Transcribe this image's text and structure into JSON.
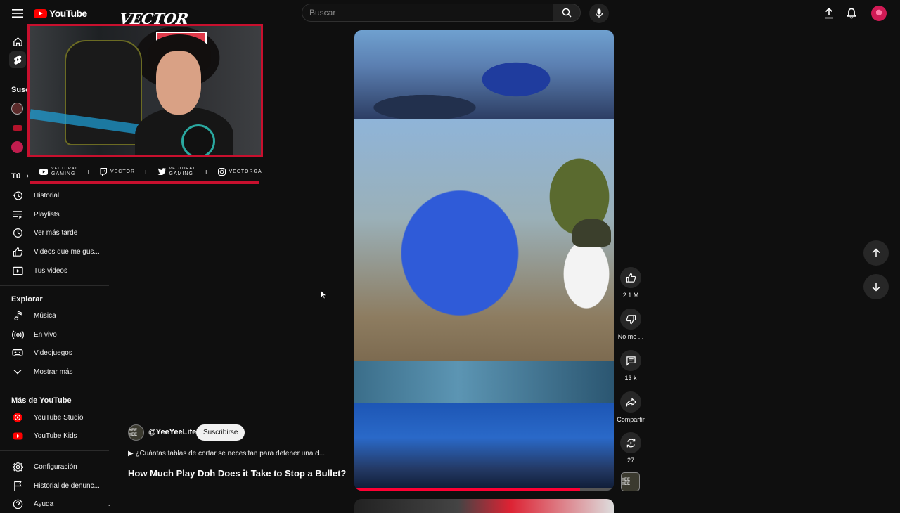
{
  "app": {
    "logo_text": "YouTube"
  },
  "search": {
    "placeholder": "Buscar"
  },
  "overlay": {
    "brand": "VECTOR",
    "socials": [
      {
        "icon": "youtube-icon",
        "line1": "VECTORAT",
        "line2": "GAMING"
      },
      {
        "icon": "twitch-icon",
        "line1": "VECTOR",
        "line2": ""
      },
      {
        "icon": "twitter-icon",
        "line1": "VECTORAT",
        "line2": "GAMING"
      },
      {
        "icon": "instagram-icon",
        "line1": "VECTORGA",
        "line2": ""
      }
    ]
  },
  "sidebar": {
    "subs_heading_partial": "Susc",
    "you_heading": "Tú",
    "you_items": [
      {
        "icon": "history-icon",
        "label": "Historial"
      },
      {
        "icon": "playlists-icon",
        "label": "Playlists"
      },
      {
        "icon": "watch-later-icon",
        "label": "Ver más tarde"
      },
      {
        "icon": "liked-icon",
        "label": "Videos que me gus..."
      },
      {
        "icon": "your-videos-icon",
        "label": "Tus videos"
      }
    ],
    "explore_heading": "Explorar",
    "explore_items": [
      {
        "icon": "music-icon",
        "label": "Música"
      },
      {
        "icon": "live-icon",
        "label": "En vivo"
      },
      {
        "icon": "gaming-icon",
        "label": "Videojuegos"
      },
      {
        "icon": "chevron-down-icon",
        "label": "Mostrar más"
      }
    ],
    "more_heading": "Más de YouTube",
    "more_items": [
      {
        "icon": "youtube-studio-icon",
        "label": "YouTube Studio"
      },
      {
        "icon": "youtube-kids-icon",
        "label": "YouTube Kids"
      }
    ],
    "settings_items": [
      {
        "icon": "gear-icon",
        "label": "Configuración"
      },
      {
        "icon": "flag-icon",
        "label": "Historial de denunc..."
      },
      {
        "icon": "help-icon",
        "label": "Ayuda"
      }
    ]
  },
  "short": {
    "channel": "@YeeYeeLife",
    "channel_avatar_text": "YEE YEE",
    "subscribe_label": "Suscribirse",
    "description": "▶ ¿Cuántas tablas de cortar se necesitan para detener una d...",
    "title": "How Much Play Doh Does it Take to Stop a Bullet?",
    "progress": 0.87
  },
  "actions": {
    "likes": "2.1 M",
    "dislike_label": "No me ...",
    "comments": "13 k",
    "share_label": "Compartir",
    "remix": "27"
  },
  "colors": {
    "brand_red": "#ff0000",
    "overlay_red": "#c8102e",
    "progress_red": "#ff0033"
  }
}
